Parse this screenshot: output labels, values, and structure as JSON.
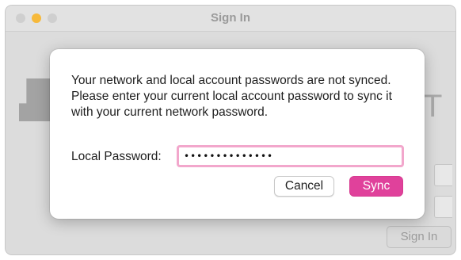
{
  "window": {
    "title": "Sign In"
  },
  "background": {
    "logo_letter": "T",
    "sign_in_label": "Sign In"
  },
  "dialog": {
    "message": "Your network and local account passwords are not synced. Please enter your current local account password to sync it with your current network password.",
    "password_label": "Local Password:",
    "password_value": "••••••••••••••",
    "cancel_label": "Cancel",
    "sync_label": "Sync"
  },
  "colors": {
    "accent": "#e0419b",
    "focus_ring": "#f2a7cc"
  },
  "icons": {
    "close": "traffic-close-icon",
    "minimize": "traffic-minimize-icon",
    "zoom": "traffic-zoom-icon",
    "logo": "brand-logo-icon"
  }
}
